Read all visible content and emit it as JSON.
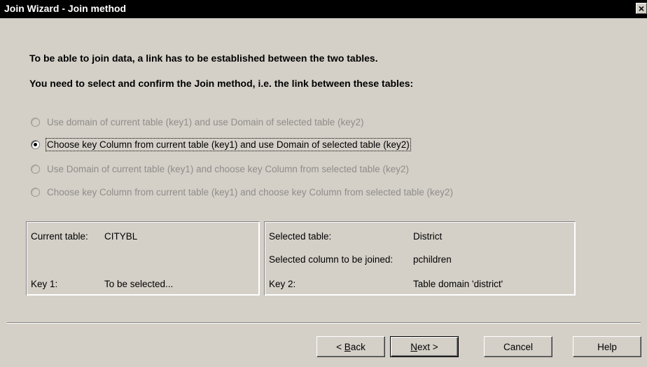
{
  "window": {
    "title": "Join Wizard - Join method",
    "close_glyph": "×"
  },
  "intro": {
    "line1": "To be able to join data, a link has to be established between the two tables.",
    "line2": "You need to select and confirm the Join method, i.e. the link between these tables:"
  },
  "options": [
    {
      "label": "Use domain of current table (key1) and use Domain of selected table (key2)",
      "enabled": false,
      "selected": false
    },
    {
      "label": "Choose key Column from current table (key1) and use Domain of selected table (key2)",
      "enabled": true,
      "selected": true
    },
    {
      "label": "Use Domain of current table (key1) and choose key Column from selected table (key2)",
      "enabled": false,
      "selected": false
    },
    {
      "label": "Choose key Column from current table (key1) and choose key Column from selected table (key2)",
      "enabled": false,
      "selected": false
    }
  ],
  "current": {
    "table_label": "Current table:",
    "table_value": "CITYBL",
    "key_label": "Key 1:",
    "key_value": "To be selected..."
  },
  "selected": {
    "table_label": "Selected table:",
    "table_value": "District",
    "column_label": "Selected column to be joined:",
    "column_value": "pchildren",
    "key_label": "Key 2:",
    "key_value": "Table domain 'district'"
  },
  "buttons": {
    "back_prefix": "< ",
    "back_mnemonic": "B",
    "back_rest": "ack",
    "next_mnemonic": "N",
    "next_rest": "ext >",
    "cancel": "Cancel",
    "help": "Help"
  },
  "colors": {
    "titlebar": "#000000",
    "dialog_face": "#d4d0c8",
    "disabled_text": "#8f8d89"
  }
}
